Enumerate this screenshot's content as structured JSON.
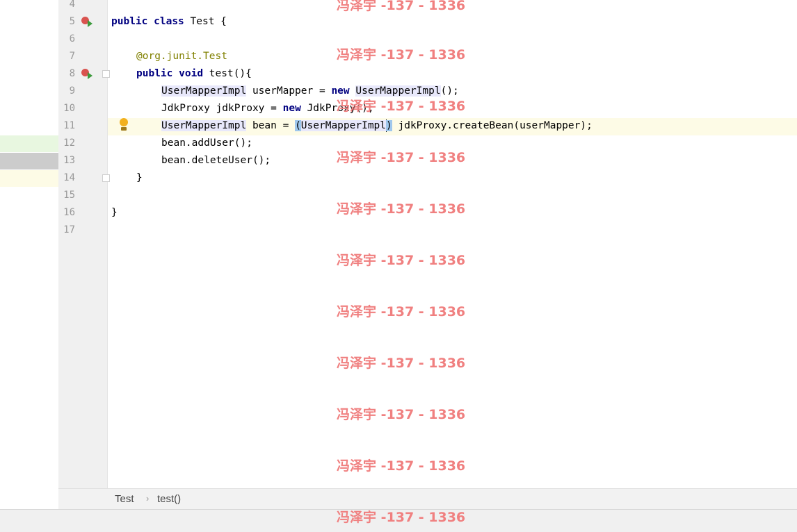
{
  "editor": {
    "line_numbers": [
      "4",
      "5",
      "6",
      "7",
      "8",
      "9",
      "10",
      "11",
      "12",
      "13",
      "14",
      "15",
      "16",
      "17"
    ],
    "lines": {
      "l5": {
        "kw1": "public",
        "kw2": "class",
        "rest": " Test {"
      },
      "l7": {
        "at": "@org.junit.",
        "name": "Test"
      },
      "l8": {
        "kw1": "public",
        "kw2": "void",
        "rest": " test(){"
      },
      "l9": {
        "type": "UserMapperImpl",
        "mid": " userMapper = ",
        "kw": "new",
        "type2": "UserMapperImpl",
        "end": "();"
      },
      "l10": {
        "a": "JdkProxy jdkProxy = ",
        "kw": "new",
        "b": " JdkProxy();"
      },
      "l11": {
        "type": "UserMapperImpl",
        "mid": " bean = ",
        "open": "(",
        "cast": "UserMapperImpl",
        "close": ")",
        "end": " jdkProxy.createBean(userMapper);"
      },
      "l12": "bean.addUser();",
      "l13": "bean.deleteUser();",
      "l14": "}",
      "l16": "}"
    }
  },
  "breadcrumb": {
    "class_name": "Test",
    "separator": "›",
    "method": "test()"
  },
  "watermark": "冯泽宇 -137 - 1336",
  "colors": {
    "keyword": "#000080",
    "annotation": "#808000",
    "caret_line": "#fdfbe6",
    "watermark": "#f08080"
  }
}
